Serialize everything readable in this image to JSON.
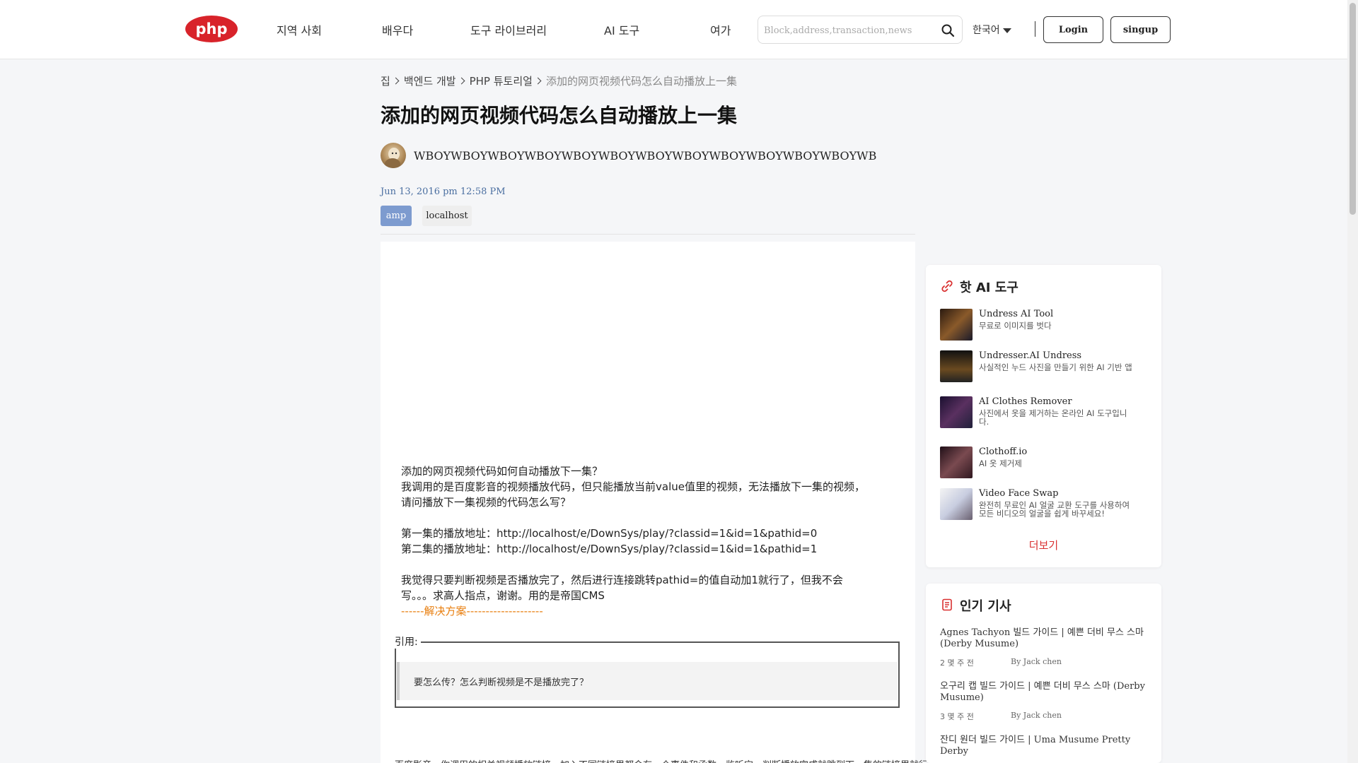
{
  "header": {
    "logo_text": "php",
    "nav": [
      "지역 사회",
      "배우다",
      "도구 라이브러리",
      "AI 도구",
      "여가"
    ],
    "search_placeholder": "Block,address,transaction,news",
    "language": "한국어",
    "login_label": "Login",
    "signup_label": "singup"
  },
  "breadcrumb": [
    "집",
    "백엔드 개발",
    "PHP 튜토리얼",
    "添加的网页视频代码怎么自动播放上一集"
  ],
  "article": {
    "title": "添加的网页视频代码怎么自动播放上一集",
    "author": "WBOYWBOYWBOYWBOYWBOYWBOYWBOYWBOYWBOYWBOYWBOYWBOYWB",
    "date": "Jun 13, 2016 pm 12:58 PM",
    "tags": [
      "amp",
      "localhost"
    ],
    "body_lines": [
      "添加的网页视频代码如何自动播放下一集？",
      "我调用的是百度影音的视频播放代码，但只能播放当前value值里的视频，无法播放下一集的视频，",
      "请问播放下一集视频的代码怎么写？",
      "",
      "第一集的播放地址：http://localhost/e/DownSys/play/?classid=1&id=1&pathid=0",
      "第二集的播放地址：http://localhost/e/DownSys/play/?classid=1&id=1&pathid=1",
      "",
      "我觉得只要判断视频是否播放完了，然后进行连接跳转pathid=的值自动加1就行了，但我不会",
      "写。。。求高人指点，谢谢。用的是帝国CMS"
    ],
    "solution_line": "------解决方案--------------------",
    "quote_label": "引用:",
    "quote_text": "要怎么传？怎么判断视频是不是播放完了？",
    "bottom_line": "百度影音，你调用的相关视频播放链接，加入不同链接里都会有一个事件和函数，监听它，判断播放完成就跳到下一集的链接里就行了"
  },
  "hot_tools": {
    "title": "핫 AI 도구",
    "items": [
      {
        "name": "Undress AI Tool",
        "desc": "무료로 이미지를 벗다"
      },
      {
        "name": "Undresser.AI Undress",
        "desc": "사실적인 누드 사진을 만들기 위한 AI 기반 앱"
      },
      {
        "name": "AI Clothes Remover",
        "desc": "사진에서 옷을 제거하는 온라인 AI 도구입니다."
      },
      {
        "name": "Clothoff.io",
        "desc": "AI 옷 제거제"
      },
      {
        "name": "Video Face Swap",
        "desc": "완전히 무료인 AI 얼굴 교환 도구를 사용하여 모든 비디오의 얼굴을 쉽게 바꾸세요!"
      }
    ],
    "more_label": "더보기"
  },
  "popular": {
    "title": "인기 기사",
    "items": [
      {
        "title": "Agnes Tachyon 빌드 가이드 | 예쁜 더비 무스 스마 (Derby Musume)",
        "time": "2 몇 주 전",
        "author": "By Jack chen"
      },
      {
        "title": "오구리 캡 빌드 가이드 | 예쁜 더비 무스 스마 (Derby Musume)",
        "time": "3 몇 주 전",
        "author": "By Jack chen"
      },
      {
        "title": "잔디 원더 빌드 가이드 | Uma Musume Pretty Derby",
        "time": "",
        "author": ""
      }
    ]
  },
  "colors": {
    "accent_red": "#d93030",
    "tag_blue": "#7d9bcf",
    "solution_orange": "#e87d0c",
    "logo_red": "#d8232a"
  }
}
